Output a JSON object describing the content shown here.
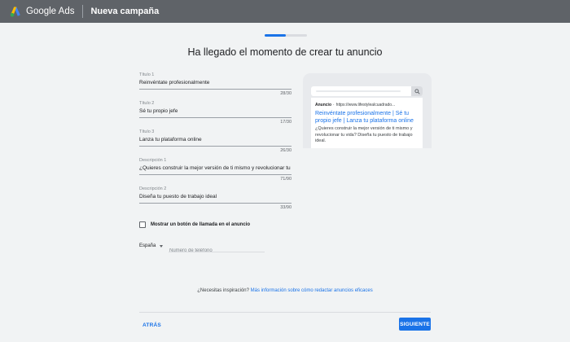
{
  "header": {
    "brand": "Google Ads",
    "campaign_title": "Nueva campaña",
    "logo_icon": "google-ads-logo"
  },
  "progress": {
    "fraction": 0.5
  },
  "heading": "Ha llegado el momento de crear tu anuncio",
  "fields": [
    {
      "label": "Título 1",
      "value": "Reinvéntate profesionalmente",
      "count": "28/30"
    },
    {
      "label": "Título 2",
      "value": "Sé tu propio jefe",
      "count": "17/30"
    },
    {
      "label": "Título 3",
      "value": "Lanza tu plataforma online",
      "count": "26/30"
    },
    {
      "label": "Descripción 1",
      "value": "¿Quieres construir la mejor versión de ti mismo y revolucionar tu vida?",
      "count": "71/90"
    },
    {
      "label": "Descripción 2",
      "value": "Diseña tu puesto de trabajo ideal",
      "count": "33/90"
    }
  ],
  "call_button": {
    "label": "Mostrar un botón de llamada en el anuncio",
    "checked": false
  },
  "phone": {
    "country": "España",
    "placeholder": "Número de teléfono"
  },
  "preview": {
    "ad_badge": "Anuncio",
    "separator": "·",
    "url": "https://www.lifestylealcuadrado...",
    "title": "Reinvéntate profesionalmente | Sé tu propio jefe | Lanza tu plataforma online",
    "description": "¿Quieres construir la mejor versión de ti mismo y revolucionar tu vida? Diseña tu puesto de trabajo ideal."
  },
  "inspiration": {
    "text": "¿Necesitas inspiración?",
    "link": "Más información sobre cómo redactar anuncios eficaces"
  },
  "actions": {
    "back": "ATRÁS",
    "next": "SIGUIENTE"
  },
  "colors": {
    "accent": "#1a73e8",
    "topbar": "#5f6368",
    "background": "#f1f3f4"
  }
}
